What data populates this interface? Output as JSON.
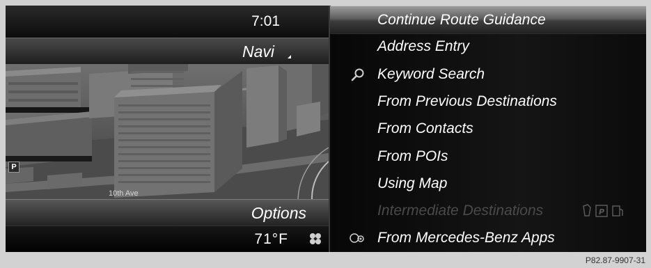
{
  "status": {
    "time": "7:01",
    "temperature": "71°F"
  },
  "left_panel": {
    "navi_label": "Navi",
    "options_label": "Options",
    "map": {
      "street_label": "10th Ave",
      "parking_icon_letter": "P"
    }
  },
  "menu": {
    "items": [
      {
        "label": "Continue Route Guidance",
        "selected": true,
        "enabled": true,
        "icon": ""
      },
      {
        "label": "Address Entry",
        "selected": false,
        "enabled": true,
        "icon": ""
      },
      {
        "label": "Keyword Search",
        "selected": false,
        "enabled": true,
        "icon": "magnifier-icon"
      },
      {
        "label": "From Previous Destinations",
        "selected": false,
        "enabled": true,
        "icon": ""
      },
      {
        "label": "From Contacts",
        "selected": false,
        "enabled": true,
        "icon": ""
      },
      {
        "label": "From POIs",
        "selected": false,
        "enabled": true,
        "icon": ""
      },
      {
        "label": "Using Map",
        "selected": false,
        "enabled": true,
        "icon": ""
      },
      {
        "label": "Intermediate Destinations",
        "selected": false,
        "enabled": false,
        "icon": ""
      },
      {
        "label": "From Mercedes-Benz Apps",
        "selected": false,
        "enabled": true,
        "icon": "mercedes-apps-icon"
      }
    ],
    "intermediate_icons": [
      "poi-icon",
      "parking-icon",
      "fuel-icon"
    ]
  },
  "caption": "P82.87-9907-31",
  "colors": {
    "menu_text": "#ffffff",
    "disabled_text": "#4a4a4a",
    "highlight": "#8a8a8a"
  }
}
